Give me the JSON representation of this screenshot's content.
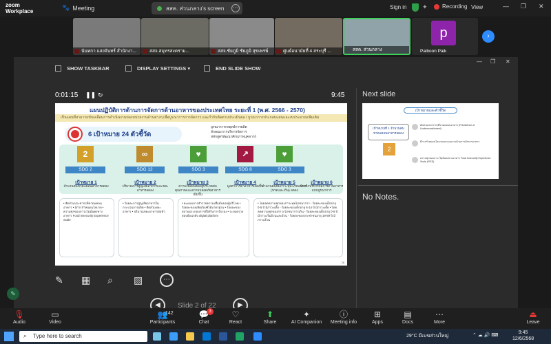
{
  "topbar": {
    "logo": [
      "zoom",
      "Workplace"
    ],
    "meeting_label": "Meeting",
    "screen_share_label": "สสค. ส่วนกลาง's screen",
    "signin": "Sign in",
    "recording": "Recording",
    "view": "View"
  },
  "participants": [
    {
      "name": "นันทกา แสงจันทร์ สำนักงา..."
    },
    {
      "name": "สสจ.สมุทรสงคราม..."
    },
    {
      "name": "สสจ.ชัยภูมิ ชัยภูมิ สุขเพรพ์"
    },
    {
      "name": "ศูนย์อนามัยที่ 4 สระบุรี ..."
    },
    {
      "name": "สสค. ส่วนกลาง"
    },
    {
      "name": "Paiboon Paik",
      "initial": "p"
    }
  ],
  "presenter": {
    "toolbar": {
      "show_taskbar": "SHOW TASKBAR",
      "display_settings": "DISPLAY SETTINGS ▾",
      "end_slide_show": "END SLIDE SHOW"
    },
    "timer": "0:01:15",
    "clock": "9:45",
    "next_slide_label": "Next slide",
    "notes": "No Notes.",
    "slide_nav": "Slide 2 of 22"
  },
  "slide": {
    "title": "แผนปฏิบัติการด้านการจัดการด้านอาหารของประเทศไทย ระยะที่ 1 (พ.ศ. 2566 - 2570)",
    "subtitle": "เป็นแผนที่สามารถขับเคลื่อนการดำเนินงานของหน่วยงานด้านต่างๆ เพื่อบูรณาการการจัดการ และกำกับติดตามประเมินผล / บูรณาการประกอบแผนและงบประมาณเพิ่มเติม",
    "goal_text": "6 เป้าหมาย 24 ตัวชี้วัด",
    "bullets": [
      "บูรณาการกลยุทธ์การผลิต",
      "ลักษณะการบริหารจัดการ",
      "หลักสูตรพัฒนาศักยภาพบุคลากร"
    ],
    "sdgs": [
      {
        "label": "SDG 2",
        "icon": "2",
        "color": "#d3a029"
      },
      {
        "label": "SDG 12",
        "icon": "∞",
        "color": "#bf8b2e"
      },
      {
        "label": "SDG 3",
        "icon": "♥",
        "color": "#4c9f38"
      },
      {
        "label": "SDG 8",
        "icon": "↗",
        "color": "#a21942"
      },
      {
        "label": "SDG 3",
        "icon": "♥",
        "color": "#4c9f38"
      }
    ],
    "goals": [
      {
        "head": "เป้าหมาย 1",
        "desc": "จำนวนคนขาดแคลนอาหารลดลง"
      },
      {
        "head": "เป้าหมาย 2",
        "desc": "ปริมาณการสูญเสียอาหารและขยะอาหารลดลง"
      },
      {
        "head": "เป้าหมาย 3",
        "desc": "ความเชื่อมั่นของผู้บริโภคต่อคุณภาพและความปลอดภัยอาหารเพิ่มขึ้น"
      },
      {
        "head": "เป้าหมาย 4",
        "desc": "มูลค่าการค้าอาหารเพิ่มขึ้น"
      },
      {
        "head": "เป้าหมาย 5",
        "desc": "จำนวนคนที่มีภาวะทุพโภชนาการ (ขาดและเกิน) ลดลง"
      },
      {
        "head": "เป้าหมาย 6",
        "desc": "มีกลไกบริหารจัดการด้านอาหารแบบบูรณาการ"
      }
    ],
    "box1": "• สัดส่วนประชากรที่ขาดแคลนอาหาร • มีการกำหนดนโยบาย • ความชุกของภาวะไม่มั่นคงทางอาหาร Food Insecurity Experience Scale",
    "box2": "• ร้อยละการสูญเสียอาหารในกระบวนการผลิต • สัดส่วนขยะอาหาร • ปริมาณขยะอาหารต่อหัว",
    "box3": "• คะแนนการสำรวจความเชื่อมั่นของผู้บริโภค • ร้อยละของผลิตภัณฑ์ได้มาตรฐาน • ร้อยละของสถานประกอบการที่ได้รับการรับรอง • ระบบตรวจสอบย้อนกลับ digital platform",
    "box4": "• โดยลดความชุกของภาวะทุพโภชนาการ - ร้อยละของเด็กอายุ 0-5 ปี มีภาวะเตี้ย - ร้อยละของเด็กอายุ 6-14 ปี มีภาวะเตี้ย • โดยลดความชุกของภาวะโภชนาการเกิน - ร้อยละของเด็กอายุ 0-5 ปี มีภาวะเริ่มอ้วนและอ้วน - ร้อยละของประชาชนอายุ 19-59 ปี มีภาวะอ้วน",
    "page_number": "28"
  },
  "next_slide": {
    "pill": "เป้าหมายและตัวชี้วัด",
    "left_label": "เป้าหมายที่ 1 จำนวนคนขาดแคลนอาหารลดลง",
    "rows": [
      "สัดส่วนประชากรที่ขาดแคลนอาหาร (Prevalence of Undernourishment)",
      "มีการกำหนดนโยบายและแผนงานด้านการจัดการอาหาร",
      "ความชุกของภาวะไม่มั่นคงทางอาหาร Food Insecurity Experience Scale (FIES)"
    ]
  },
  "zoombar": {
    "audio": "Audio",
    "video": "Video",
    "participants": "Participants",
    "participants_count": "142",
    "chat": "Chat",
    "chat_badge": "3",
    "react": "React",
    "share": "Share",
    "ai": "AI Companion",
    "info": "Meeting info",
    "apps": "Apps",
    "docs": "Docs",
    "more": "More",
    "leave": "Leave"
  },
  "taskbar": {
    "search_placeholder": "Type here to search",
    "weather": "29°C มีเมฆส่วนใหญ่",
    "time": "9:45",
    "date": "12/6/2568"
  }
}
